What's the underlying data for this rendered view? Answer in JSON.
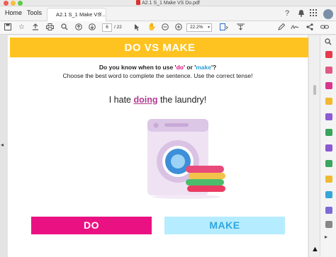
{
  "window": {
    "title": "A2.1 S_1 Make VS Do.pdf"
  },
  "tabs": {
    "home": "Home",
    "tools": "Tools",
    "document": "A2.1 S_1 Make VS...",
    "close_glyph": "×"
  },
  "toolbar": {
    "page_current": "6",
    "page_total": "/ 22",
    "zoom": "22.2%"
  },
  "worksheet": {
    "banner_title": "DO VS MAKE",
    "question_prefix": "Do you know when to use '",
    "question_do": "do",
    "question_mid": "' or '",
    "question_make": "make",
    "question_suffix": "'?",
    "instruction": "Choose the best word to complete the sentence. Use the correct tense!",
    "sentence_before": "I hate ",
    "sentence_answer": "doing",
    "sentence_after": " the laundry!",
    "option_do": "DO",
    "option_make": "MAKE"
  },
  "icons": {
    "tabbar_right": [
      "help-icon",
      "bell-icon",
      "apps-icon",
      "user-avatar"
    ],
    "toolbar": [
      "save-icon",
      "bookmark-icon",
      "upload-icon",
      "print-icon",
      "zoom-search-icon",
      "prev-page-icon",
      "next-page-icon",
      "select-cursor-icon",
      "hand-icon",
      "zoom-out-icon",
      "zoom-in-icon",
      "fit-page-icon",
      "scroll-mode-icon",
      "edit-text-icon",
      "sign-icon",
      "share-icon",
      "link-icon"
    ],
    "right_panel": [
      "search-icon",
      "export-pdf-icon",
      "create-pdf-icon",
      "edit-pdf-icon",
      "comment-icon",
      "fill-sign-icon",
      "organize-icon",
      "request-signature-icon",
      "scan-icon",
      "protect-icon",
      "more-tools-icon"
    ]
  },
  "colors": {
    "banner": "#fec320",
    "do_button": "#ea1183",
    "make_button": "#b6ecff",
    "make_text": "#2ea6df",
    "answer_word": "#b23a8f"
  }
}
